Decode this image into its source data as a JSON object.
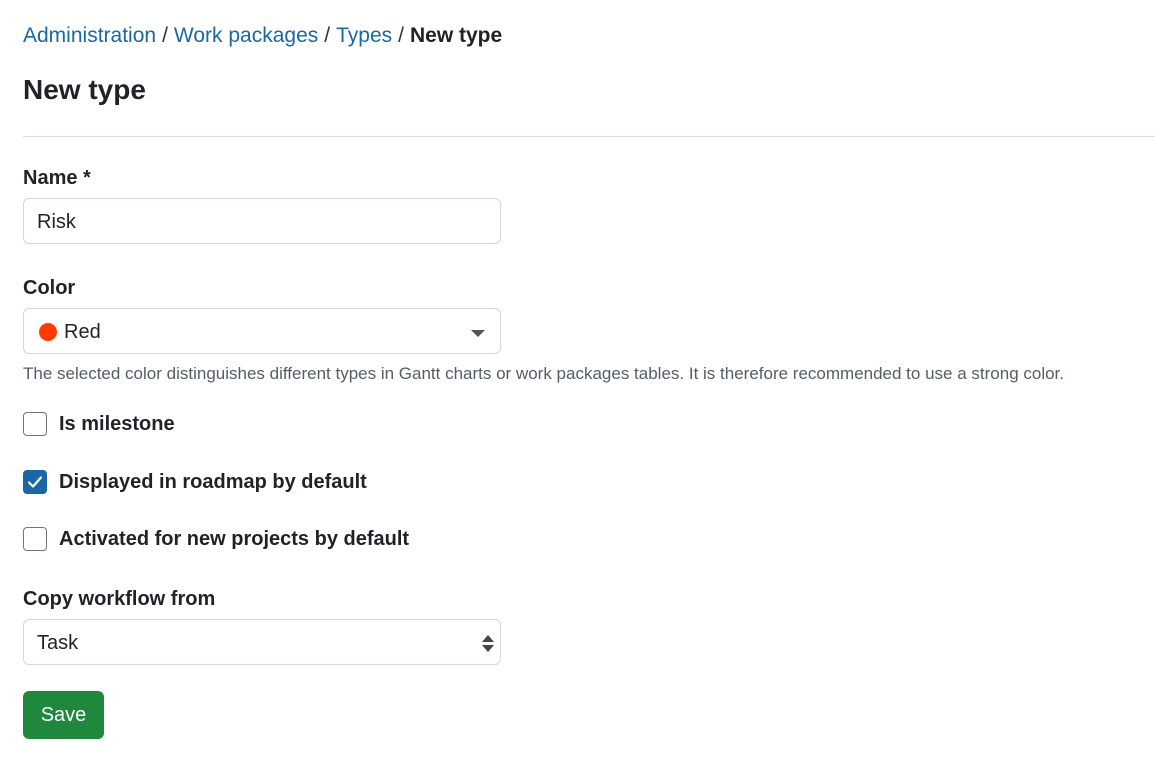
{
  "breadcrumb": {
    "items": [
      "Administration",
      "Work packages",
      "Types"
    ],
    "current": "New type",
    "separator": "/"
  },
  "page": {
    "title": "New type"
  },
  "form": {
    "name": {
      "label": "Name *",
      "value": "Risk"
    },
    "color": {
      "label": "Color",
      "selected": "Red",
      "swatch_color": "#ff3b00",
      "help": "The selected color distinguishes different types in Gantt charts or work packages tables. It is therefore recommended to use a strong color."
    },
    "checkboxes": [
      {
        "label": "Is milestone",
        "checked": false
      },
      {
        "label": "Displayed in roadmap by default",
        "checked": true
      },
      {
        "label": "Activated for new projects by default",
        "checked": false
      }
    ],
    "copy_workflow": {
      "label": "Copy workflow from",
      "selected": "Task"
    },
    "save_label": "Save"
  },
  "colors": {
    "link": "#1a67a3",
    "primary_button": "#1f883d",
    "checkbox_checked": "#1a67a3"
  }
}
